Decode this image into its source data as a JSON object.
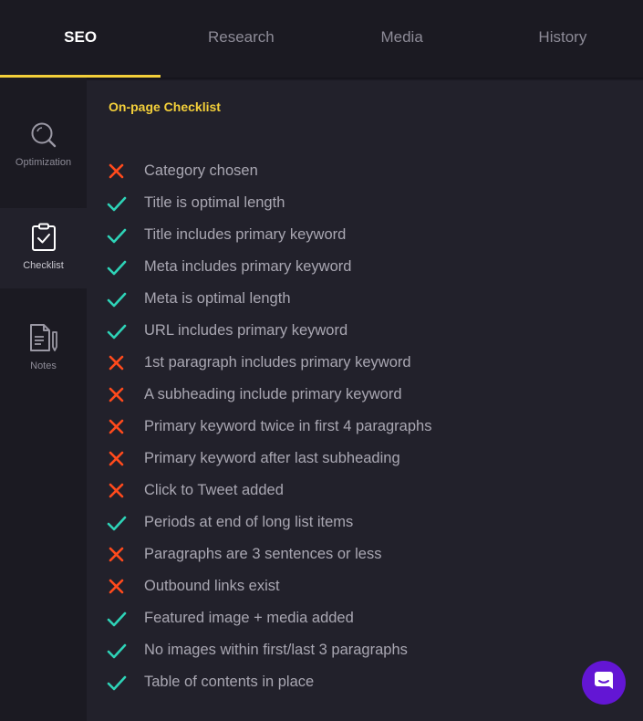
{
  "tabs": [
    {
      "label": "SEO",
      "active": true
    },
    {
      "label": "Research",
      "active": false
    },
    {
      "label": "Media",
      "active": false
    },
    {
      "label": "History",
      "active": false
    }
  ],
  "sidebar": {
    "items": [
      {
        "label": "Optimization",
        "icon": "magnifier-icon"
      },
      {
        "label": "Checklist",
        "icon": "clipboard-check-icon",
        "active": true
      },
      {
        "label": "Notes",
        "icon": "note-pen-icon"
      }
    ]
  },
  "checklist": {
    "title": "On-page Checklist",
    "items": [
      {
        "label": "Category chosen",
        "status": "fail"
      },
      {
        "label": "Title is optimal length",
        "status": "pass"
      },
      {
        "label": "Title includes primary keyword",
        "status": "pass"
      },
      {
        "label": "Meta includes primary keyword",
        "status": "pass"
      },
      {
        "label": "Meta is optimal length",
        "status": "pass"
      },
      {
        "label": "URL includes primary keyword",
        "status": "pass"
      },
      {
        "label": "1st paragraph includes primary keyword",
        "status": "fail"
      },
      {
        "label": "A subheading include primary keyword",
        "status": "fail"
      },
      {
        "label": "Primary keyword twice in first 4 paragraphs",
        "status": "fail"
      },
      {
        "label": "Primary keyword after last subheading",
        "status": "fail"
      },
      {
        "label": "Click to Tweet added",
        "status": "fail"
      },
      {
        "label": "Periods at end of long list items",
        "status": "pass"
      },
      {
        "label": "Paragraphs are 3 sentences or less",
        "status": "fail"
      },
      {
        "label": "Outbound links exist",
        "status": "fail"
      },
      {
        "label": "Featured image + media added",
        "status": "pass"
      },
      {
        "label": "No images within first/last 3 paragraphs",
        "status": "pass"
      },
      {
        "label": "Table of contents in place",
        "status": "pass"
      }
    ]
  },
  "colors": {
    "accent": "#f3cf3a",
    "pass": "#2ed3b7",
    "fail": "#ff4a1c",
    "chat": "#6316d4"
  },
  "chat": {
    "icon": "chat-bubble-icon"
  }
}
